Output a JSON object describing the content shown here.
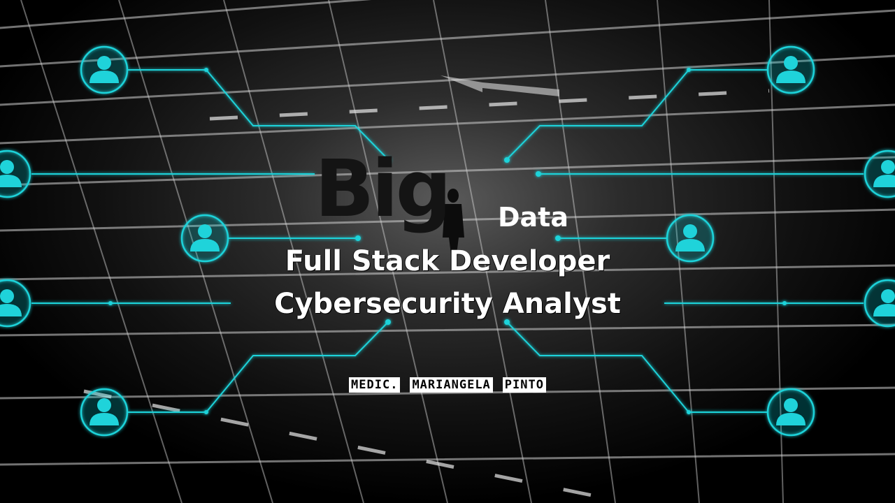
{
  "slide": {
    "title_big": "Big",
    "title_small": "Data",
    "role_1": "Full Stack Developer",
    "role_2": "Cybersecurity Analyst",
    "author_words": [
      "MEDIC.",
      "MARIANGELA",
      "PINTO"
    ]
  },
  "icons": {
    "user": "user-icon"
  },
  "colors": {
    "accent": "#1fd3da",
    "background": "#000000",
    "text": "#ffffff",
    "title_big": "#141414"
  }
}
